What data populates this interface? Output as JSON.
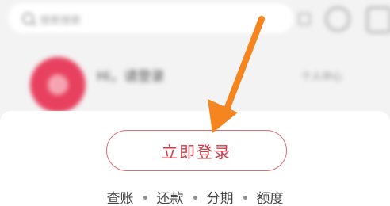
{
  "search": {
    "placeholder": "搜索搜索"
  },
  "header": {
    "greeting": "Hi，请登录",
    "right_link": "个人中心"
  },
  "login": {
    "button_label": "立即登录"
  },
  "quick_links": [
    {
      "label": "查账"
    },
    {
      "label": "还款"
    },
    {
      "label": "分期"
    },
    {
      "label": "额度"
    }
  ],
  "colors": {
    "accent": "#cf3c47",
    "avatar": "#e8415f",
    "arrow": "#f5861f"
  }
}
